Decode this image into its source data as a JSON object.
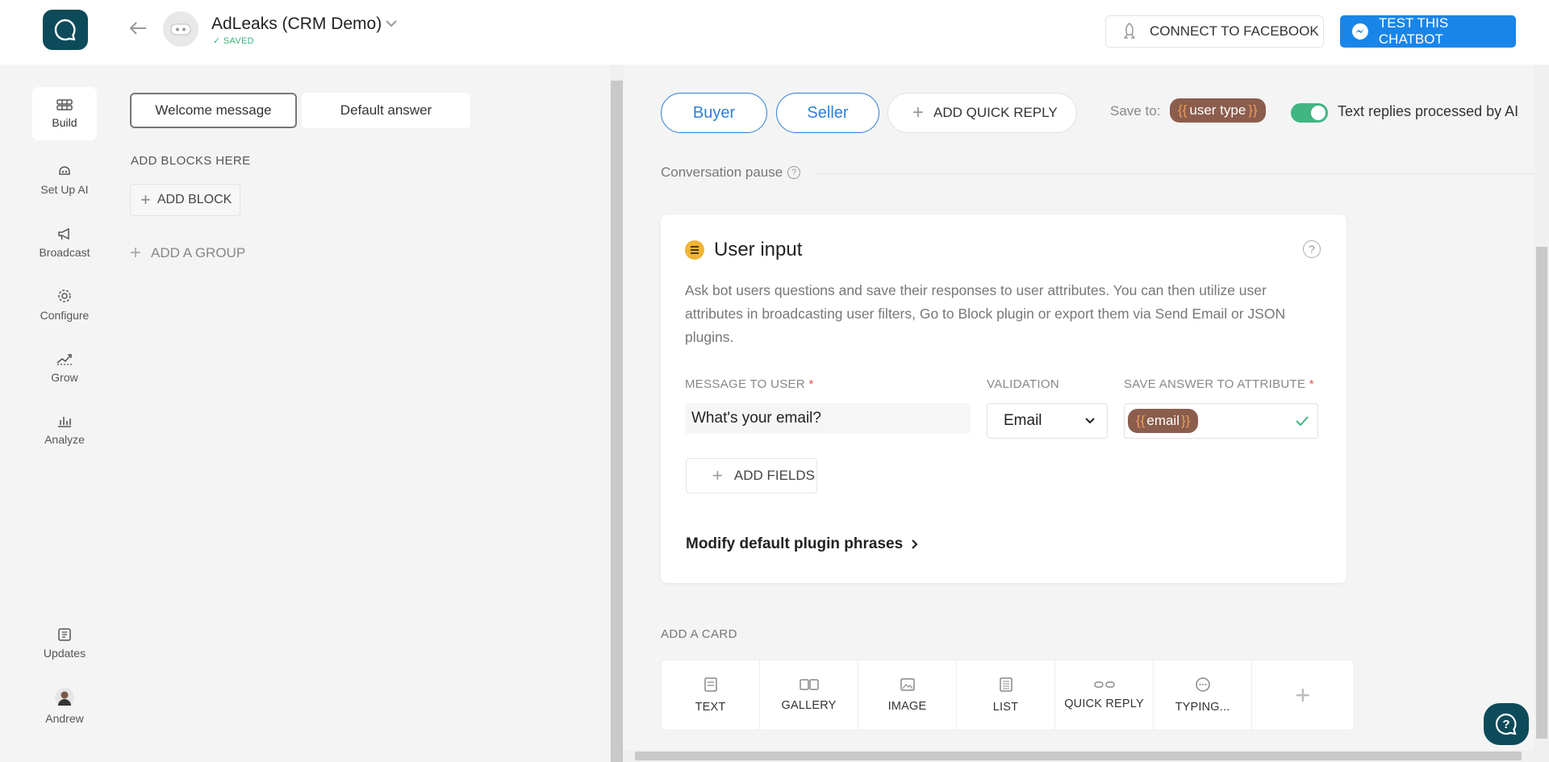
{
  "header": {
    "bot_name": "AdLeaks (CRM Demo)",
    "status": "SAVED",
    "connect_label": "CONNECT TO FACEBOOK",
    "test_label": "TEST THIS CHATBOT",
    "brand_color": "#0e4b5a",
    "test_button_color": "#1a85e8"
  },
  "nav": {
    "items": [
      {
        "label": "Build",
        "icon": "build-icon",
        "active": true
      },
      {
        "label": "Set Up AI",
        "icon": "ai-icon"
      },
      {
        "label": "Broadcast",
        "icon": "megaphone-icon"
      },
      {
        "label": "Configure",
        "icon": "gear-icon"
      },
      {
        "label": "Grow",
        "icon": "growth-icon"
      },
      {
        "label": "Analyze",
        "icon": "bar-chart-icon"
      },
      {
        "label": "Updates",
        "icon": "updates-icon"
      },
      {
        "label": "Andrew",
        "icon": "user-avatar"
      }
    ]
  },
  "blocks": {
    "tabs": [
      "Welcome message",
      "Default answer"
    ],
    "selected_tab": "Welcome message",
    "section_label": "ADD BLOCKS HERE",
    "add_block_label": "ADD BLOCK",
    "add_group_label": "ADD A GROUP"
  },
  "quick_replies": {
    "items": [
      "Buyer",
      "Seller"
    ],
    "add_label": "ADD QUICK REPLY",
    "save_to_label": "Save to:",
    "save_to_attr": "user type",
    "ai_toggle_label": "Text replies processed by AI",
    "ai_toggle_on": true,
    "attr_color": "#8b5d4d",
    "toggle_color": "#41b682"
  },
  "pause": {
    "label": "Conversation pause"
  },
  "user_input_card": {
    "title": "User input",
    "description": "Ask bot users questions and save their responses to user attributes. You can then utilize user attributes in broadcasting user filters, Go to Block plugin or export them via Send Email or JSON plugins.",
    "message_label": "MESSAGE TO USER",
    "validation_label": "VALIDATION",
    "save_attr_label": "SAVE ANSWER TO ATTRIBUTE",
    "message_value": "What's your email?",
    "validation_value": "Email",
    "attr_value": "email",
    "add_fields_label": "ADD FIELDS",
    "modify_label": "Modify default plugin phrases"
  },
  "add_card": {
    "label": "ADD A CARD",
    "tools": [
      {
        "label": "TEXT",
        "icon": "text-icon"
      },
      {
        "label": "GALLERY",
        "icon": "gallery-icon"
      },
      {
        "label": "IMAGE",
        "icon": "image-icon"
      },
      {
        "label": "LIST",
        "icon": "list-icon"
      },
      {
        "label": "QUICK REPLY",
        "icon": "quick-reply-icon"
      },
      {
        "label": "TYPING...",
        "icon": "typing-icon"
      },
      {
        "label": "",
        "icon": "plus-icon"
      }
    ]
  }
}
